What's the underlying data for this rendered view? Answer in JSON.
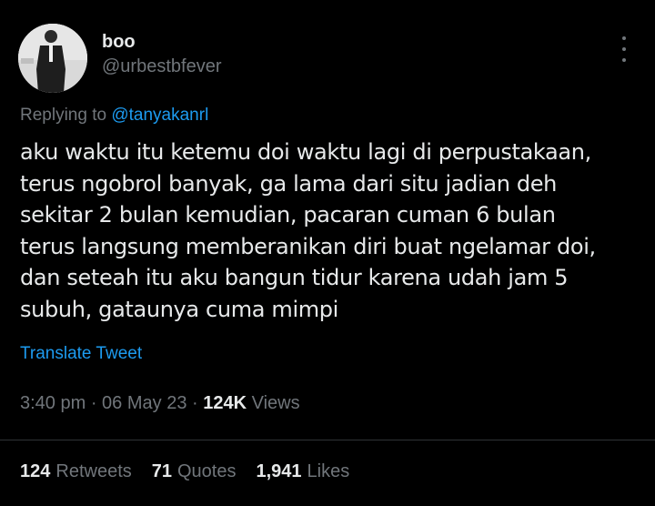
{
  "author": {
    "display_name": "boo",
    "handle": "@urbestbfever"
  },
  "reply": {
    "prefix": "Replying to",
    "mention": "@tanyakanrl"
  },
  "tweet": {
    "lines": [
      "aku waktu itu ketemu doi waktu lagi di perpustakaan,",
      "terus ngobrol banyak, ga lama dari situ jadian deh",
      "sekitar 2 bulan kemudian, pacaran cuman 6 bulan",
      "terus langsung memberanikan diri buat ngelamar doi,",
      "dan seteah itu aku bangun tidur karena udah jam 5",
      "subuh, gataunya cuma mimpi"
    ],
    "translate_label": "Translate Tweet"
  },
  "meta": {
    "time": "3:40 pm",
    "date": "06 May 23",
    "views_count": "124K",
    "views_label": "Views",
    "separator": " · "
  },
  "stats": {
    "retweets_count": "124",
    "retweets_label": "Retweets",
    "quotes_count": "71",
    "quotes_label": "Quotes",
    "likes_count": "1,941",
    "likes_label": "Likes"
  },
  "colors": {
    "background": "#000000",
    "text": "#e7e9ea",
    "secondary": "#71767b",
    "accent": "#1d9bf0"
  },
  "icons": {
    "more": "more-vertical-icon"
  }
}
